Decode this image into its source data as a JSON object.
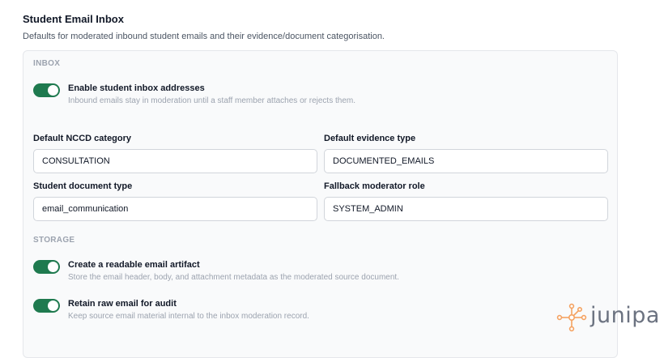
{
  "header": {
    "title": "Student Email Inbox",
    "subtitle": "Defaults for moderated inbound student emails and their evidence/document categorisation."
  },
  "inbox": {
    "section_label": "INBOX",
    "toggle": {
      "label": "Enable student inbox addresses",
      "description": "Inbound emails stay in moderation until a staff member attaches or rejects them.",
      "enabled": true
    }
  },
  "fields": {
    "nccd_category": {
      "label": "Default NCCD category",
      "value": "CONSULTATION"
    },
    "evidence_type": {
      "label": "Default evidence type",
      "value": "DOCUMENTED_EMAILS"
    },
    "document_type": {
      "label": "Student document type",
      "value": "email_communication"
    },
    "moderator_role": {
      "label": "Fallback moderator role",
      "value": "SYSTEM_ADMIN"
    }
  },
  "storage": {
    "section_label": "STORAGE",
    "artifact_toggle": {
      "label": "Create a readable email artifact",
      "description": "Store the email header, body, and attachment metadata as the moderated source document.",
      "enabled": true
    },
    "raw_toggle": {
      "label": "Retain raw email for audit",
      "description": "Keep source email material internal to the inbox moderation record.",
      "enabled": true
    }
  },
  "brand": {
    "name": "junipa",
    "icon": "network-nodes-icon",
    "color": "#f4a261"
  },
  "colors": {
    "toggle_on": "#1f7a4f",
    "panel_bg": "#f9fafb"
  }
}
